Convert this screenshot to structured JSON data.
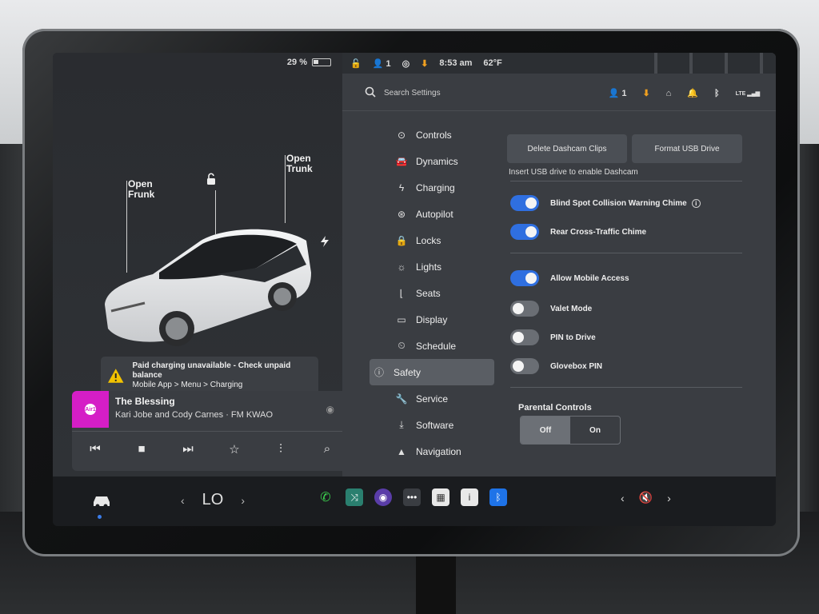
{
  "status": {
    "battery": "29 %",
    "passengers": "1",
    "time": "8:53 am",
    "temperature": "62°F"
  },
  "car": {
    "open_frunk": "Open\nFrunk",
    "open_trunk": "Open\nTrunk"
  },
  "alert": {
    "title": "Paid charging unavailable - Check unpaid balance",
    "path": "Mobile App > Menu > Charging"
  },
  "media": {
    "art_label": "Air1",
    "title": "The Blessing",
    "artist": "Kari Jobe and Cody Carnes · FM KWAO"
  },
  "search": {
    "placeholder": "Search Settings"
  },
  "top_icons": {
    "profile_count": "1",
    "lte": "LTE"
  },
  "nav": {
    "items": [
      {
        "label": "Controls",
        "icon": "toggle-icon"
      },
      {
        "label": "Dynamics",
        "icon": "car-icon"
      },
      {
        "label": "Charging",
        "icon": "bolt-icon"
      },
      {
        "label": "Autopilot",
        "icon": "steering-wheel-icon"
      },
      {
        "label": "Locks",
        "icon": "lock-icon"
      },
      {
        "label": "Lights",
        "icon": "sun-icon"
      },
      {
        "label": "Seats",
        "icon": "seat-icon"
      },
      {
        "label": "Display",
        "icon": "display-icon"
      },
      {
        "label": "Schedule",
        "icon": "clock-icon"
      },
      {
        "label": "Safety",
        "icon": "info-icon",
        "active": true
      },
      {
        "label": "Service",
        "icon": "wrench-icon"
      },
      {
        "label": "Software",
        "icon": "download-icon"
      },
      {
        "label": "Navigation",
        "icon": "arrow-icon"
      }
    ]
  },
  "safety": {
    "delete_dashcam": "Delete Dashcam Clips",
    "format_usb": "Format USB Drive",
    "usb_hint": "Insert USB drive to enable Dashcam",
    "blind_spot": "Blind Spot Collision Warning Chime",
    "rear_cross": "Rear Cross-Traffic Chime",
    "mobile_access": "Allow Mobile Access",
    "valet_mode": "Valet Mode",
    "pin_to_drive": "PIN to Drive",
    "glovebox_pin": "Glovebox PIN",
    "parental_controls": "Parental Controls",
    "off": "Off",
    "on": "On",
    "toggles": {
      "blind_spot": true,
      "rear_cross": true,
      "mobile_access": true,
      "valet_mode": false,
      "pin_to_drive": false,
      "glovebox_pin": false
    }
  },
  "climate": {
    "temp": "LO"
  },
  "colors": {
    "accent": "#2f6fe0",
    "phone": "#3ccf4e",
    "media_art": "#d51ec6",
    "bluetooth": "#1e73e8"
  }
}
